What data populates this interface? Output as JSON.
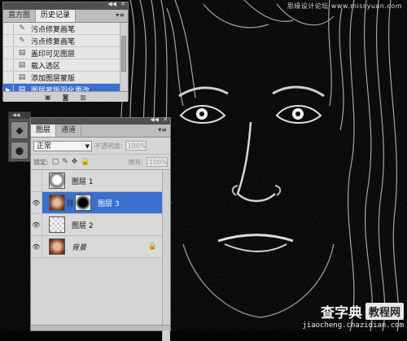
{
  "canvas": {
    "description_free": true
  },
  "watermark_top": "思缘设计论坛 www.missyuan.com",
  "site_logo": {
    "name": "查字典",
    "badge": "教程网",
    "url": "jiaocheng.chazidian.com"
  },
  "history_panel": {
    "tabs": [
      "直方图",
      "历史记录"
    ],
    "active_tab": 1,
    "items": [
      {
        "label": "污点修复画笔",
        "icon": "brush-icon"
      },
      {
        "label": "污点修复画笔",
        "icon": "brush-icon"
      },
      {
        "label": "盖印可见图层",
        "icon": "doc-icon"
      },
      {
        "label": "载入选区",
        "icon": "doc-icon"
      },
      {
        "label": "添加图层蒙版",
        "icon": "doc-icon"
      },
      {
        "label": "图层蒙版羽化更改",
        "icon": "doc-icon",
        "selected": true
      }
    ],
    "colors": {
      "selected": "#3a6ecf"
    }
  },
  "layers_panel": {
    "tabs": [
      "图层",
      "通道"
    ],
    "blend_mode": "正常",
    "opacity_label": "不透明度:",
    "opacity_value": "100%",
    "lock_label": "锁定:",
    "fill_label": "填充:",
    "fill_value": "100%",
    "layers": [
      {
        "name": "图层 1",
        "visible": false,
        "thumb": "sketch",
        "mask": false,
        "selected": false,
        "locked": false,
        "italic": false
      },
      {
        "name": "图层 3",
        "visible": true,
        "thumb": "face",
        "mask": true,
        "selected": true,
        "locked": false,
        "italic": false
      },
      {
        "name": "图层 2",
        "visible": true,
        "thumb": "checker",
        "mask": false,
        "selected": false,
        "locked": false,
        "italic": false
      },
      {
        "name": "背景",
        "visible": true,
        "thumb": "face",
        "mask": false,
        "selected": false,
        "locked": true,
        "italic": true
      }
    ]
  }
}
